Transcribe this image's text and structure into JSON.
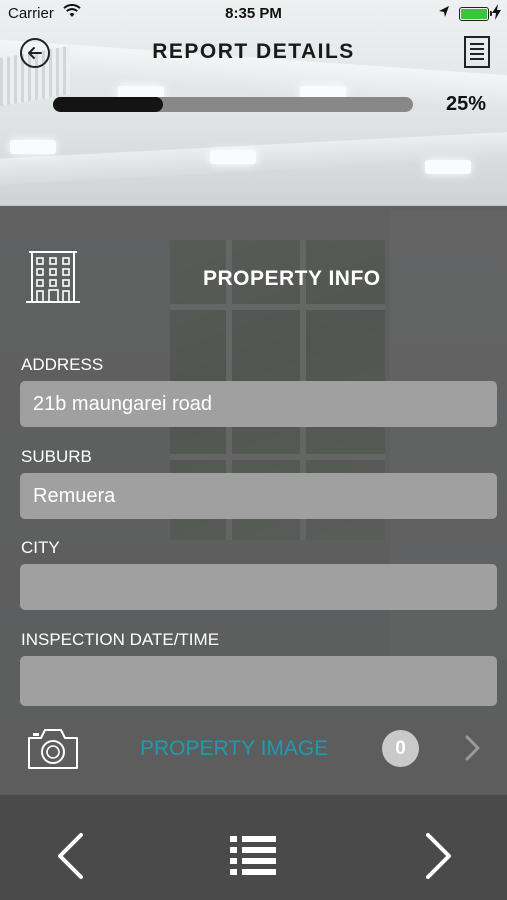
{
  "status_bar": {
    "carrier": "Carrier",
    "time": "8:35 PM"
  },
  "header": {
    "title": "REPORT DETAILS",
    "back_icon": "circle-arrow-left-icon",
    "menu_icon": "document-list-icon"
  },
  "progress": {
    "value": 0.25,
    "label": "25%"
  },
  "section": {
    "title": "PROPERTY INFO",
    "icon": "building-icon"
  },
  "fields": [
    {
      "label": "ADDRESS",
      "value": "21b maungarei road"
    },
    {
      "label": "SUBURB",
      "value": "Remuera"
    },
    {
      "label": "CITY",
      "value": ""
    },
    {
      "label": "INSPECTION DATE/TIME",
      "value": ""
    }
  ],
  "property_image": {
    "label": "PROPERTY IMAGE",
    "count": "0",
    "icon": "camera-icon"
  },
  "colors": {
    "accent": "#1f9bb0",
    "progress_fill": "#141414",
    "input_bg": "#a0a0a0"
  },
  "bottom_nav": {
    "prev_icon": "chevron-left-icon",
    "list_icon": "list-icon",
    "next_icon": "chevron-right-icon"
  }
}
